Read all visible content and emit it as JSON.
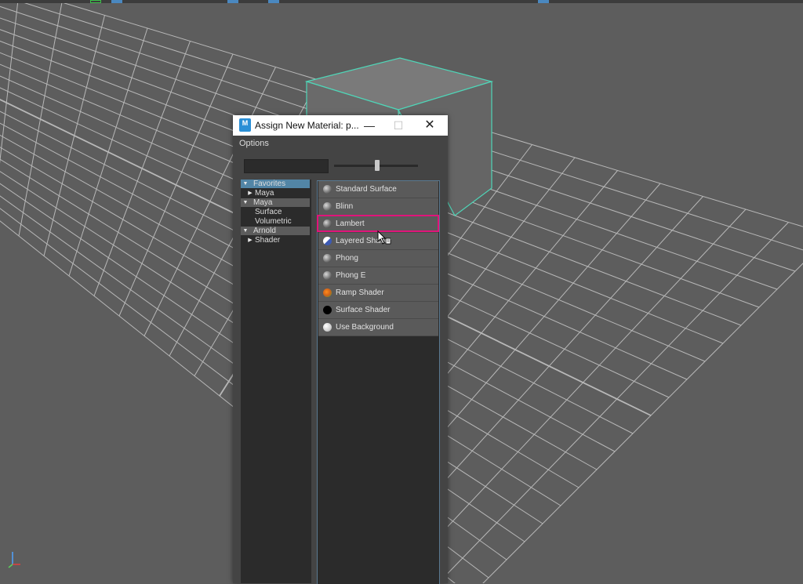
{
  "dialog": {
    "title": "Assign New Material: p...",
    "app_icon_letter": "M",
    "minimize_icon": "minimize-icon",
    "maximize_icon": "maximize-icon",
    "close_icon": "close-icon",
    "menu": {
      "options": "Options"
    }
  },
  "tree": [
    {
      "label": "Favorites",
      "kind": "category",
      "expanded": true,
      "selected": true
    },
    {
      "label": "Maya",
      "kind": "child-collapsed"
    },
    {
      "label": "Maya",
      "kind": "category",
      "expanded": true
    },
    {
      "label": "Surface",
      "kind": "leaf"
    },
    {
      "label": "Volumetric",
      "kind": "leaf"
    },
    {
      "label": "Arnold",
      "kind": "category",
      "expanded": true
    },
    {
      "label": "Shader",
      "kind": "child-collapsed"
    }
  ],
  "materials": [
    {
      "label": "Standard Surface",
      "swatch": "#8a8a8a"
    },
    {
      "label": "Blinn",
      "swatch": "#8d8d8d"
    },
    {
      "label": "Lambert",
      "swatch": "#808080",
      "highlighted": true
    },
    {
      "label": "Layered Shader",
      "swatch": "split-blue-white"
    },
    {
      "label": "Phong",
      "swatch": "#8a8a8a"
    },
    {
      "label": "Phong E",
      "swatch": "#8a8a8a"
    },
    {
      "label": "Ramp Shader",
      "swatch": "orange-green"
    },
    {
      "label": "Surface Shader",
      "swatch": "#000000"
    },
    {
      "label": "Use Background",
      "swatch": "#cfcfcf"
    }
  ],
  "colors": {
    "highlight_border": "#e0147a",
    "selection_outline": "#4fd6b8",
    "tree_selected": "#5285a6"
  }
}
